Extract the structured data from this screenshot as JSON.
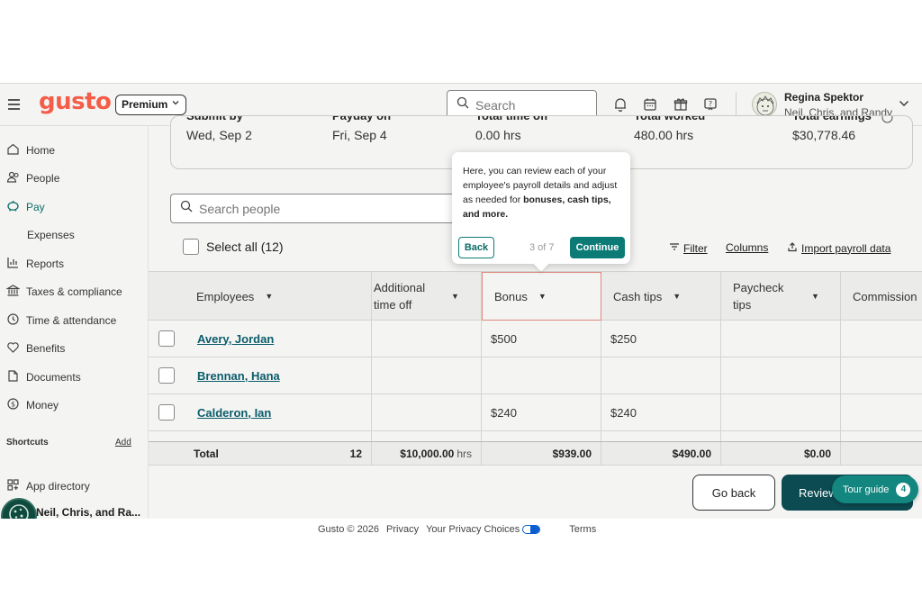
{
  "header": {
    "logo": "gusto",
    "plan": "Premium",
    "search_placeholder": "Search",
    "user_name": "Regina Spektor",
    "company": "Neil, Chris, and Randy"
  },
  "sidebar": {
    "items": [
      {
        "label": "Home",
        "icon": "home-icon"
      },
      {
        "label": "People",
        "icon": "people-icon"
      },
      {
        "label": "Pay",
        "icon": "piggy-bank-icon"
      },
      {
        "label": "Expenses",
        "icon": ""
      },
      {
        "label": "Reports",
        "icon": "chart-icon"
      },
      {
        "label": "Taxes & compliance",
        "icon": "bank-icon"
      },
      {
        "label": "Time & attendance",
        "icon": "clock-icon"
      },
      {
        "label": "Benefits",
        "icon": "heart-icon"
      },
      {
        "label": "Documents",
        "icon": "documents-icon"
      },
      {
        "label": "Money",
        "icon": "dollar-icon"
      }
    ],
    "shortcuts_label": "Shortcuts",
    "shortcuts_add": "Add",
    "app_directory": "App directory",
    "company_switch": "Neil, Chris, and Ra..."
  },
  "summary": {
    "submit_by_label": "Submit by",
    "submit_by_value": "Wed, Sep 2",
    "payday_label": "Payday on",
    "payday_value": "Fri, Sep 4",
    "time_off_label": "Total time off",
    "time_off_value": "0.00 hrs",
    "worked_label": "Total worked",
    "worked_value": "480.00 hrs",
    "earnings_label": "Total earnings",
    "earnings_value": "$30,778.46"
  },
  "toolbar": {
    "search_people_placeholder": "Search people",
    "select_all": "Select all (12)",
    "filter": "Filter",
    "columns": "Columns",
    "import": "Import payroll data"
  },
  "table": {
    "headers": [
      "Employees",
      "Additional time off",
      "Bonus",
      "Cash tips",
      "Paycheck tips",
      "Commission"
    ],
    "rows": [
      {
        "name": "Avery, Jordan",
        "time_off": "",
        "bonus": "$500",
        "cash_tips": "$250",
        "paycheck_tips": "",
        "commission": ""
      },
      {
        "name": "Brennan, Hana",
        "time_off": "",
        "bonus": "",
        "cash_tips": "",
        "paycheck_tips": "",
        "commission": ""
      },
      {
        "name": "Calderon, Ian",
        "time_off": "",
        "bonus": "$240",
        "cash_tips": "$240",
        "paycheck_tips": "",
        "commission": ""
      }
    ],
    "total": {
      "label": "Total",
      "count": "12",
      "time_off": "$10,000.00",
      "time_off_unit": "hrs",
      "bonus": "$939.00",
      "cash_tips": "$490.00",
      "paycheck_tips": "$0.00"
    }
  },
  "popover": {
    "text_1": "Here, you can review each of your employee's payroll details and adjust as needed for ",
    "text_bold": "bonuses, cash tips, and more.",
    "back": "Back",
    "step": "3 of 7",
    "continue": "Continue"
  },
  "actions": {
    "go_back": "Go back",
    "review": "Review",
    "tour_guide": "Tour guide",
    "tour_count": "4"
  },
  "footer": {
    "copyright": "Gusto © 2026",
    "privacy": "Privacy",
    "privacy_choices": "Your Privacy Choices",
    "terms": "Terms"
  },
  "colors": {
    "brand": "#f45d48",
    "primary": "#0c4b52",
    "accent": "#12867f"
  }
}
